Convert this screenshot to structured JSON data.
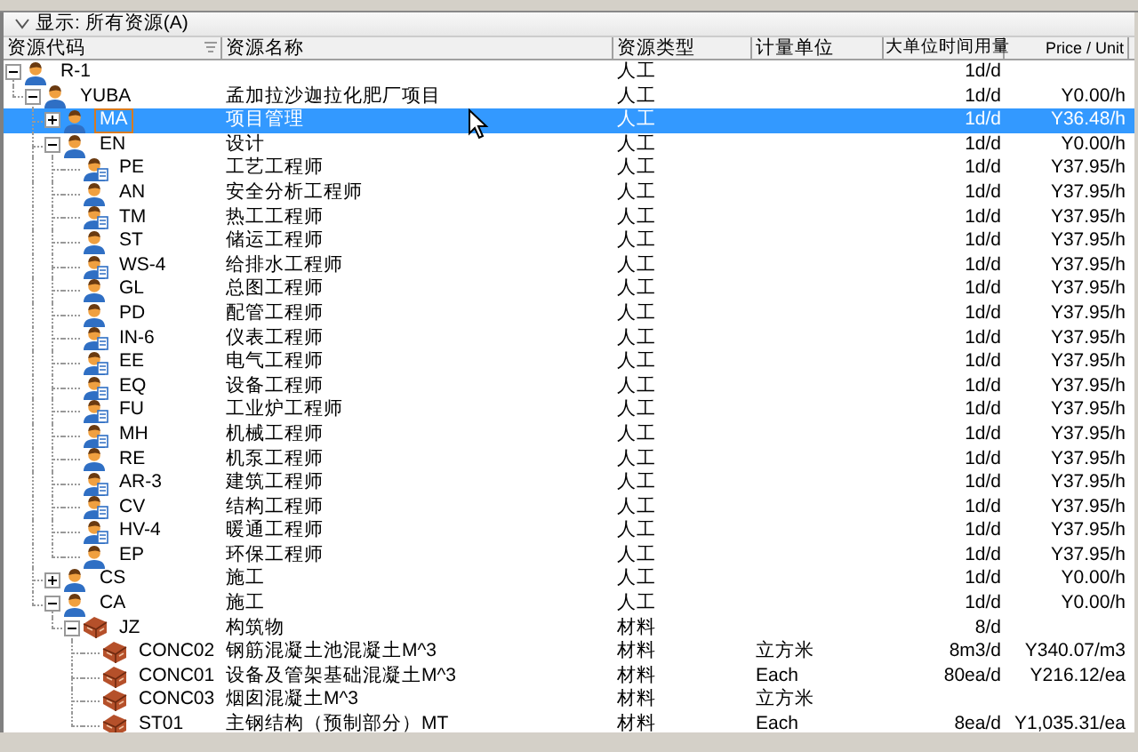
{
  "filter_bar": {
    "label": "显示: 所有资源(A)"
  },
  "columns": [
    {
      "label": "资源代码",
      "filter": true
    },
    {
      "label": "资源名称"
    },
    {
      "label": "资源类型"
    },
    {
      "label": "计量单位"
    },
    {
      "label": "大单位时间用量"
    },
    {
      "label": "Price / Unit"
    }
  ],
  "resources": [
    {
      "code": "R-1",
      "type": "人工",
      "quantity": "1d/d",
      "kind": "labor",
      "selected": false,
      "expanded": true,
      "children": [
        {
          "code": "YUBA",
          "name": "孟加拉沙迦拉化肥厂项目",
          "type": "人工",
          "quantity": "1d/d",
          "price": "Y0.00/h",
          "kind": "labor",
          "selected": false,
          "expanded": true,
          "children": [
            {
              "code": "MA",
              "name": "项目管理",
              "type": "人工",
              "quantity": "1d/d",
              "price": "Y36.48/h",
              "kind": "labor",
              "selected": true,
              "expanded": false
            },
            {
              "code": "EN",
              "name": "设计",
              "type": "人工",
              "quantity": "1d/d",
              "price": "Y0.00/h",
              "kind": "labor",
              "selected": false,
              "expanded": true,
              "children": [
                {
                  "code": "PE",
                  "name": "工艺工程师",
                  "type": "人工",
                  "quantity": "1d/d",
                  "price": "Y37.95/h",
                  "kind": "labor-doc",
                  "selected": false
                },
                {
                  "code": "AN",
                  "name": "安全分析工程师",
                  "type": "人工",
                  "quantity": "1d/d",
                  "price": "Y37.95/h",
                  "kind": "labor",
                  "selected": false
                },
                {
                  "code": "TM",
                  "name": "热工工程师",
                  "type": "人工",
                  "quantity": "1d/d",
                  "price": "Y37.95/h",
                  "kind": "labor-doc",
                  "selected": false
                },
                {
                  "code": "ST",
                  "name": "储运工程师",
                  "type": "人工",
                  "quantity": "1d/d",
                  "price": "Y37.95/h",
                  "kind": "labor",
                  "selected": false
                },
                {
                  "code": "WS-4",
                  "name": "给排水工程师",
                  "type": "人工",
                  "quantity": "1d/d",
                  "price": "Y37.95/h",
                  "kind": "labor-doc",
                  "selected": false
                },
                {
                  "code": "GL",
                  "name": "总图工程师",
                  "type": "人工",
                  "quantity": "1d/d",
                  "price": "Y37.95/h",
                  "kind": "labor",
                  "selected": false
                },
                {
                  "code": "PD",
                  "name": "配管工程师",
                  "type": "人工",
                  "quantity": "1d/d",
                  "price": "Y37.95/h",
                  "kind": "labor",
                  "selected": false
                },
                {
                  "code": "IN-6",
                  "name": "仪表工程师",
                  "type": "人工",
                  "quantity": "1d/d",
                  "price": "Y37.95/h",
                  "kind": "labor-doc",
                  "selected": false
                },
                {
                  "code": "EE",
                  "name": "电气工程师",
                  "type": "人工",
                  "quantity": "1d/d",
                  "price": "Y37.95/h",
                  "kind": "labor-doc",
                  "selected": false
                },
                {
                  "code": "EQ",
                  "name": "设备工程师",
                  "type": "人工",
                  "quantity": "1d/d",
                  "price": "Y37.95/h",
                  "kind": "labor-doc",
                  "selected": false
                },
                {
                  "code": "FU",
                  "name": "工业炉工程师",
                  "type": "人工",
                  "quantity": "1d/d",
                  "price": "Y37.95/h",
                  "kind": "labor-doc",
                  "selected": false
                },
                {
                  "code": "MH",
                  "name": "机械工程师",
                  "type": "人工",
                  "quantity": "1d/d",
                  "price": "Y37.95/h",
                  "kind": "labor-doc",
                  "selected": false
                },
                {
                  "code": "RE",
                  "name": "机泵工程师",
                  "type": "人工",
                  "quantity": "1d/d",
                  "price": "Y37.95/h",
                  "kind": "labor",
                  "selected": false
                },
                {
                  "code": "AR-3",
                  "name": "建筑工程师",
                  "type": "人工",
                  "quantity": "1d/d",
                  "price": "Y37.95/h",
                  "kind": "labor-doc",
                  "selected": false
                },
                {
                  "code": "CV",
                  "name": "结构工程师",
                  "type": "人工",
                  "quantity": "1d/d",
                  "price": "Y37.95/h",
                  "kind": "labor-doc",
                  "selected": false
                },
                {
                  "code": "HV-4",
                  "name": "暖通工程师",
                  "type": "人工",
                  "quantity": "1d/d",
                  "price": "Y37.95/h",
                  "kind": "labor-doc",
                  "selected": false
                },
                {
                  "code": "EP",
                  "name": "环保工程师",
                  "type": "人工",
                  "quantity": "1d/d",
                  "price": "Y37.95/h",
                  "kind": "labor",
                  "selected": false
                }
              ]
            },
            {
              "code": "CS",
              "name": "施工",
              "type": "人工",
              "quantity": "1d/d",
              "price": "Y0.00/h",
              "kind": "labor",
              "selected": false,
              "expanded": false
            },
            {
              "code": "CA",
              "name": "施工",
              "type": "人工",
              "quantity": "1d/d",
              "price": "Y0.00/h",
              "kind": "labor",
              "selected": false,
              "expanded": true,
              "children": [
                {
                  "code": "JZ",
                  "name": "构筑物",
                  "type": "材料",
                  "quantity": "8/d",
                  "kind": "material",
                  "selected": false,
                  "expanded": true,
                  "children": [
                    {
                      "code": "CONC02",
                      "name": "钢筋混凝土池混凝土M^3",
                      "type": "材料",
                      "unit": "立方米",
                      "quantity": "8m3/d",
                      "price": "Y340.07/m3",
                      "kind": "material",
                      "selected": false
                    },
                    {
                      "code": "CONC01",
                      "name": "设备及管架基础混凝土M^3",
                      "type": "材料",
                      "unit": "Each",
                      "quantity": "80ea/d",
                      "price": "Y216.12/ea",
                      "kind": "material",
                      "selected": false
                    },
                    {
                      "code": "CONC03",
                      "name": "烟囱混凝土M^3",
                      "type": "材料",
                      "unit": "立方米",
                      "kind": "material",
                      "selected": false
                    },
                    {
                      "code": "ST01",
                      "name": "主钢结构（预制部分）MT",
                      "type": "材料",
                      "unit": "Each",
                      "quantity": "8ea/d",
                      "price": "Y1,035.31/ea",
                      "kind": "material",
                      "selected": false
                    }
                  ]
                }
              ]
            }
          ]
        }
      ]
    }
  ]
}
